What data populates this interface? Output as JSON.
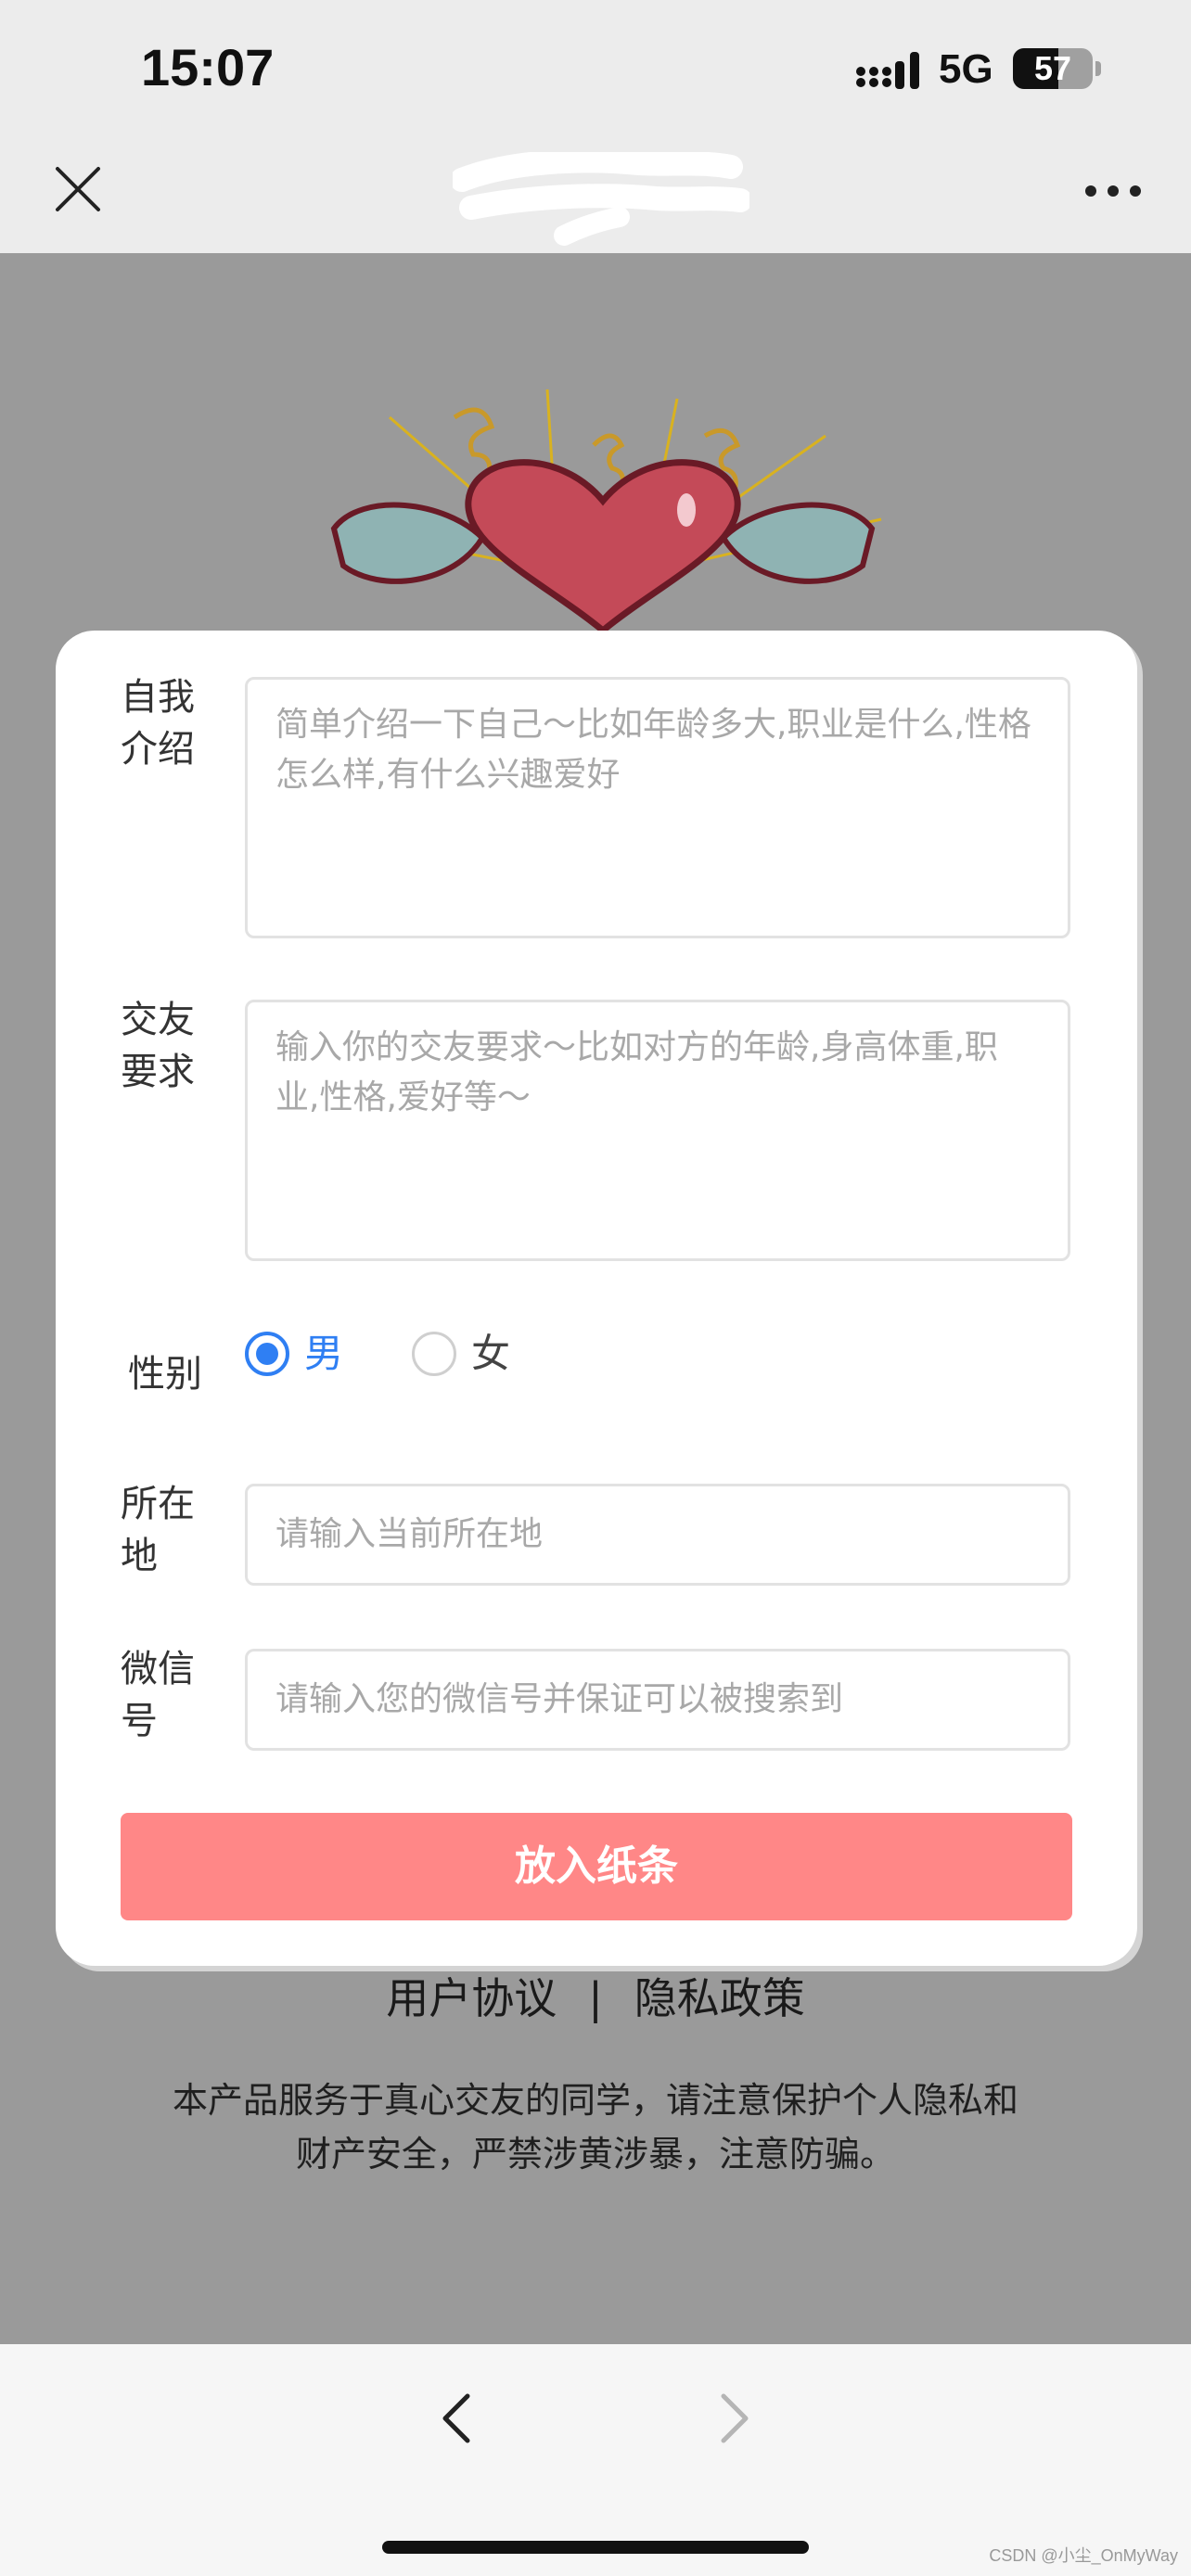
{
  "status_bar": {
    "time": "15:07",
    "network": "5G",
    "battery": "57",
    "battery_level": 0.57,
    "icons": [
      "signal-icon",
      "battery-icon"
    ]
  },
  "nav": {
    "close_icon": "close-icon",
    "more_icon": "more-icon"
  },
  "form": {
    "intro_label": "自我介绍",
    "intro_placeholder": "简单介绍一下自己～比如年龄多大,职业是什么,性格怎么样,有什么兴趣爱好",
    "requirement_label": "交友要求",
    "requirement_placeholder": "输入你的交友要求～比如对方的年龄,身高体重,职业,性格,爱好等～",
    "gender_label": "性别",
    "gender_options": [
      "男",
      "女"
    ],
    "gender_selected": "男",
    "location_label": "所在地",
    "location_placeholder": "请输入当前所在地",
    "wechat_label": "微信号",
    "wechat_placeholder": "请输入您的微信号并保证可以被搜索到",
    "submit_label": "放入纸条"
  },
  "footer": {
    "user_agreement": "用户协议",
    "separator": "|",
    "privacy_policy": "隐私政策",
    "notice": "本产品服务于真心交友的同学，请注意保护个人隐私和财产安全，严禁涉黄涉暴，注意防骗。"
  },
  "bottom_nav": {
    "back_icon": "chevron-left-icon",
    "forward_icon": "chevron-right-icon"
  },
  "watermark": "CSDN @小尘_OnMyWay",
  "colors": {
    "accent": "#2f7ff3",
    "submit": "#ff8787",
    "overlay": "#9a9a9a"
  }
}
